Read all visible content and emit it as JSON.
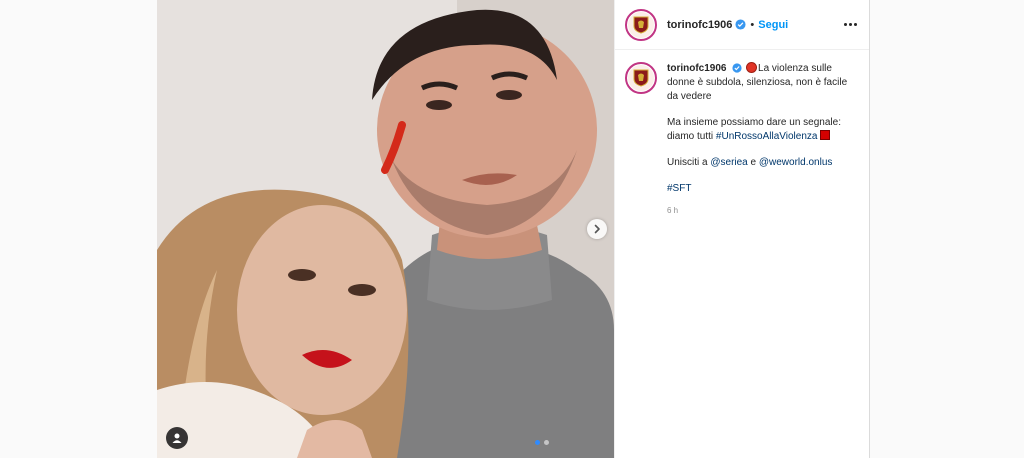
{
  "post": {
    "username": "torinofc1906",
    "follow_label": "Segui",
    "separator": "•",
    "caption": {
      "line1": "La violenza sulle donne è subdola, silenziosa, non è facile da vedere",
      "line2_prefix": "Ma insieme possiamo dare un segnale: diamo tutti ",
      "hashtag1": "#UnRossoAllaViolenza",
      "line3_prefix": "Unisciti a ",
      "mention1": "@seriea",
      "line3_mid": " e ",
      "mention2": "@weworld.onlus",
      "hashtag2": "#SFT"
    },
    "time_ago": "6 h"
  },
  "carousel": {
    "total": 2,
    "current": 1
  },
  "icons": {
    "verified": "verified-badge-icon",
    "next": "chevron-right-icon",
    "tag": "user-tag-icon",
    "more": "more-options-icon"
  },
  "colors": {
    "follow": "#0095f6",
    "link": "#00376b",
    "verified": "#3897f0",
    "red_accent": "#d40000"
  }
}
